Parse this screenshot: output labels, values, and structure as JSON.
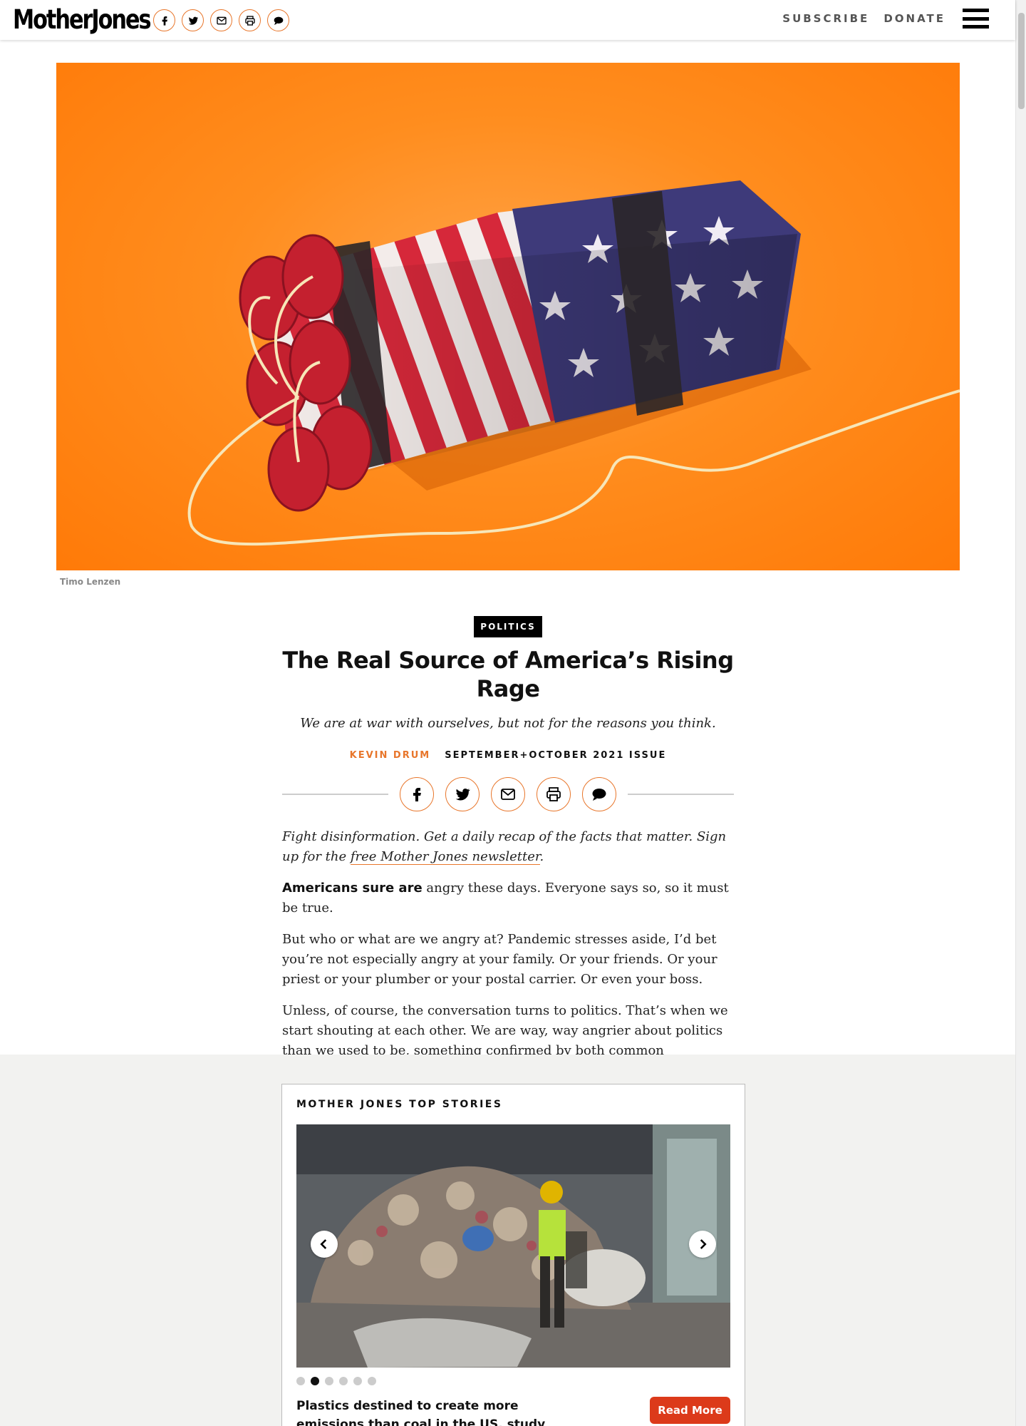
{
  "header": {
    "logo": "MotherJones",
    "share_icons": [
      "facebook-icon",
      "twitter-icon",
      "email-icon",
      "print-icon",
      "comment-icon"
    ],
    "nav": {
      "subscribe": "SUBSCRIBE",
      "donate": "DONATE"
    },
    "menu_icon": "hamburger-menu-icon"
  },
  "hero": {
    "credit": "Timo Lenzen",
    "background_color": "#ff8a1a"
  },
  "article": {
    "category": "POLITICS",
    "title": "The Real Source of America’s Rising Rage",
    "dek": "We are at war with ourselves, but not for the reasons you think.",
    "author": "KEVIN DRUM",
    "issue": "SEPTEMBER+OCTOBER 2021 ISSUE",
    "accent_color": "#e8762b",
    "promo": {
      "text": "Fight disinformation. Get a daily recap of the facts that matter. Sign up for the ",
      "link": "free Mother Jones newsletter",
      "end": "."
    },
    "paragraphs": [
      {
        "lead": "Americans sure are",
        "text": " angry these days. Everyone says so, so it must be true."
      },
      {
        "text": "But who or what are we angry at? Pandemic stresses aside, I’d bet you’re not especially angry at your family. Or your friends. Or your priest or your plumber or your postal carrier. Or even your boss."
      },
      {
        "text": "Unless, of course, the conversation turns to politics. That’s when we start shouting at each other. We are way, way angrier about politics than we used to be, something confirmed by both common experience and formal research."
      }
    ]
  },
  "top_stories": {
    "title": "MOTHER JONES TOP STORIES",
    "headline": "Plastics destined to create more emissions than coal in the US, study finds",
    "read_more": "Read More",
    "read_more_color": "#dc3a1a",
    "slide_count": 6,
    "active_slide": 2
  }
}
